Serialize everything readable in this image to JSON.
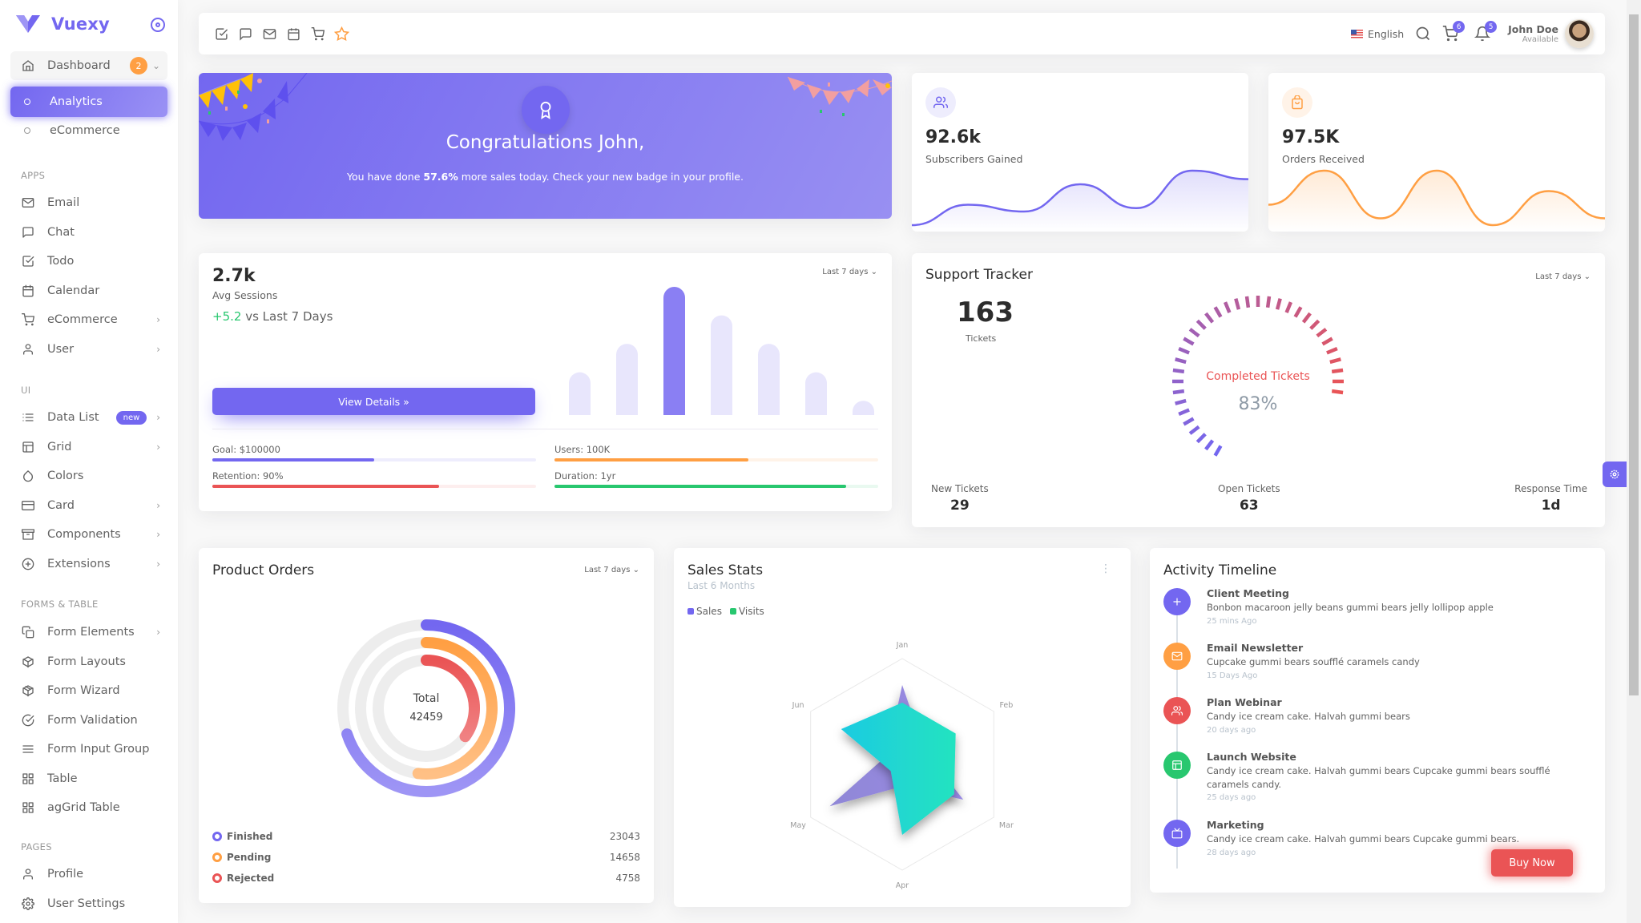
{
  "brand": {
    "name": "Vuexy",
    "accent": "#7367f0"
  },
  "sidebar": {
    "dashboard": {
      "label": "Dashboard",
      "badge": "2"
    },
    "dashboard_children": [
      {
        "label": "Analytics",
        "active": true
      },
      {
        "label": "eCommerce",
        "active": false
      }
    ],
    "sections": {
      "apps": "APPS",
      "ui": "UI",
      "forms": "FORMS & TABLE",
      "pages": "PAGES"
    },
    "apps": [
      {
        "label": "Email",
        "icon": "mail-icon"
      },
      {
        "label": "Chat",
        "icon": "chat-icon"
      },
      {
        "label": "Todo",
        "icon": "check-square-icon"
      },
      {
        "label": "Calendar",
        "icon": "calendar-icon"
      },
      {
        "label": "eCommerce",
        "icon": "cart-icon",
        "submenu": true
      },
      {
        "label": "User",
        "icon": "user-icon",
        "submenu": true
      }
    ],
    "ui": [
      {
        "label": "Data List",
        "icon": "list-icon",
        "submenu": true,
        "badge": "new"
      },
      {
        "label": "Grid",
        "icon": "layout-icon",
        "submenu": true
      },
      {
        "label": "Colors",
        "icon": "droplet-icon"
      },
      {
        "label": "Card",
        "icon": "credit-card-icon",
        "submenu": true
      },
      {
        "label": "Components",
        "icon": "archive-icon",
        "submenu": true
      },
      {
        "label": "Extensions",
        "icon": "plus-circle-icon",
        "submenu": true
      }
    ],
    "forms": [
      {
        "label": "Form Elements",
        "icon": "copy-icon",
        "submenu": true
      },
      {
        "label": "Form Layouts",
        "icon": "box-icon"
      },
      {
        "label": "Form Wizard",
        "icon": "package-icon"
      },
      {
        "label": "Form Validation",
        "icon": "check-circle-icon"
      },
      {
        "label": "Form Input Group",
        "icon": "menu-icon"
      },
      {
        "label": "Table",
        "icon": "grid-icon"
      },
      {
        "label": "agGrid Table",
        "icon": "grid-icon"
      }
    ],
    "pages": [
      {
        "label": "Profile",
        "icon": "user-icon"
      },
      {
        "label": "User Settings",
        "icon": "settings-icon"
      }
    ]
  },
  "navbar": {
    "bookmarks": [
      "check-square-icon",
      "chat-icon",
      "mail-icon",
      "calendar-icon",
      "cart-icon",
      "star-icon"
    ],
    "language": "English",
    "cart_count": "6",
    "notification_count": "5",
    "user_name": "John Doe",
    "user_status": "Available"
  },
  "congrats": {
    "title": "Congratulations John,",
    "text_before": "You have done ",
    "highlight": "57.6%",
    "text_after": " more sales today. Check your new badge in your profile."
  },
  "subscribers": {
    "value": "92.6k",
    "label": "Subscribers Gained",
    "color": "#7367f0"
  },
  "orders": {
    "value": "97.5K",
    "label": "Orders Received",
    "color": "#ff9f43"
  },
  "sessions": {
    "value": "2.7k",
    "label": "Avg Sessions",
    "change": "+5.2",
    "change_suffix": " vs Last 7 Days",
    "period": "Last 7 days",
    "button": "View Details »",
    "metrics": [
      {
        "label": "Goal: $100000",
        "percent": 50,
        "color": "#7367f0",
        "track": "#eeedfd"
      },
      {
        "label": "Users: 100K",
        "percent": 60,
        "color": "#ff9f43",
        "track": "#fff3e8"
      },
      {
        "label": "Retention: 90%",
        "percent": 70,
        "color": "#ea5455",
        "track": "#fdeeee"
      },
      {
        "label": "Duration: 1yr",
        "percent": 90,
        "color": "#28c76f",
        "track": "#e9f9f0"
      }
    ]
  },
  "support": {
    "title": "Support Tracker",
    "period": "Last 7 days",
    "total": "163",
    "total_label": "Tickets",
    "gauge_label": "Completed Tickets",
    "gauge_value": "83%",
    "stats": [
      {
        "label": "New Tickets",
        "value": "29"
      },
      {
        "label": "Open Tickets",
        "value": "63"
      },
      {
        "label": "Response Time",
        "value": "1d"
      }
    ]
  },
  "product_orders": {
    "title": "Product Orders",
    "period": "Last 7 days",
    "total_label": "Total",
    "total_value": "42459",
    "legend": [
      {
        "label": "Finished",
        "value": "23043",
        "color": "#7367f0"
      },
      {
        "label": "Pending",
        "value": "14658",
        "color": "#ff9f43"
      },
      {
        "label": "Rejected",
        "value": "4758",
        "color": "#ea5455"
      }
    ]
  },
  "sales_stats": {
    "title": "Sales Stats",
    "subtitle": "Last 6 Months",
    "menu_icon": "more-vertical-icon"
  },
  "timeline": {
    "title": "Activity Timeline",
    "items": [
      {
        "title": "Client Meeting",
        "desc": "Bonbon macaroon jelly beans gummi bears jelly lollipop apple",
        "time": "25 mins Ago",
        "color": "#7367f0",
        "icon": "plus-icon"
      },
      {
        "title": "Email Newsletter",
        "desc": "Cupcake gummi bears soufflé caramels candy",
        "time": "15 Days Ago",
        "color": "#ff9f43",
        "icon": "mail-icon"
      },
      {
        "title": "Plan Webinar",
        "desc": "Candy ice cream cake. Halvah gummi bears",
        "time": "20 days ago",
        "color": "#ea5455",
        "icon": "users-icon"
      },
      {
        "title": "Launch Website",
        "desc": "Candy ice cream cake. Halvah gummi bears Cupcake gummi bears soufflé caramels candy.",
        "time": "25 days ago",
        "color": "#28c76f",
        "icon": "layout-icon"
      },
      {
        "title": "Marketing",
        "desc": "Candy ice cream cake. Halvah gummi bears Cupcake gummi bears.",
        "time": "28 days ago",
        "color": "#7367f0",
        "icon": "tv-icon"
      }
    ]
  },
  "buy_now": "Buy Now",
  "chart_data": [
    {
      "id": "subscribers",
      "type": "area",
      "title": "Subscribers Gained",
      "series": [
        {
          "name": "Subscribers",
          "values": [
            28,
            40,
            36,
            52,
            38,
            60,
            55
          ]
        }
      ]
    },
    {
      "id": "orders",
      "type": "area",
      "title": "Orders Received",
      "series": [
        {
          "name": "Orders",
          "values": [
            10,
            15,
            8,
            15,
            7,
            12,
            8
          ]
        }
      ]
    },
    {
      "id": "sessions",
      "type": "bar",
      "title": "Avg Sessions",
      "values": [
        75,
        125,
        225,
        175,
        125,
        75,
        25
      ],
      "highlight_index": 2
    },
    {
      "id": "support_gauge",
      "type": "radialBar",
      "title": "Completed Tickets",
      "value": 83
    },
    {
      "id": "product_orders",
      "type": "radialBar",
      "title": "Product Orders",
      "categories": [
        "Finished",
        "Pending",
        "Rejected"
      ],
      "values": [
        70,
        52,
        35
      ]
    },
    {
      "id": "sales_stats",
      "type": "radar",
      "title": "Sales Stats",
      "categories": [
        "Jan",
        "Feb",
        "Mar",
        "Apr",
        "May",
        "Jun"
      ],
      "series": [
        {
          "name": "Sales",
          "values": [
            90,
            30,
            80,
            25,
            95,
            20
          ],
          "color": "#7367f0"
        },
        {
          "name": "Visits",
          "values": [
            70,
            70,
            68,
            80,
            15,
            80
          ],
          "color": "#28c76f"
        }
      ],
      "max": 120,
      "legend": "top-left"
    }
  ]
}
